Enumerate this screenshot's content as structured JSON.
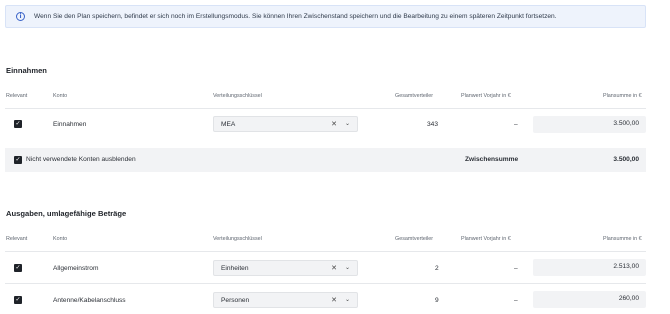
{
  "info_banner": {
    "icon": "info-icon",
    "text": "Wenn Sie den Plan speichern, befindet er sich noch im Erstellungsmodus. Sie können Ihren Zwischenstand speichern und die Bearbeitung zu einem späteren Zeitpunkt fortsetzen."
  },
  "einnahmen": {
    "title": "Einnahmen",
    "headers": {
      "relevant": "Relevant",
      "konto": "Konto",
      "verteilungsschluessel": "Verteilungsschlüssel",
      "gesamtverteiler": "Gesamtverteiler",
      "planwert": "Planwert Vorjahr in €",
      "plansumme": "Plansumme in €"
    },
    "rows": [
      {
        "konto": "Einnahmen",
        "schluessel": "MEA",
        "gesamtverteiler": "343",
        "planwert": "–",
        "plansumme": "3.500,00"
      }
    ],
    "hide_unused_label": "Nicht verwendete Konten ausblenden",
    "subtotal_label": "Zwischensumme",
    "subtotal_value": "3.500,00"
  },
  "ausgaben": {
    "title": "Ausgaben, umlagefähige Beträge",
    "headers": {
      "relevant": "Relevant",
      "konto": "Konto",
      "verteilungsschluessel": "Verteilungsschlüssel",
      "gesamtverteiler": "Gesamtverteiler",
      "planwert": "Planwert Vorjahr in €",
      "plansumme": "Plansumme in €"
    },
    "rows": [
      {
        "konto": "Allgemeinstrom",
        "schluessel": "Einheiten",
        "gesamtverteiler": "2",
        "planwert": "–",
        "plansumme": "2.513,00"
      },
      {
        "konto": "Antenne/Kabelanschluss",
        "schluessel": "Personen",
        "gesamtverteiler": "9",
        "planwert": "–",
        "plansumme": "260,00"
      }
    ]
  },
  "glyphs": {
    "check": "✓",
    "clear": "✕",
    "chevron": "⌄",
    "info": "i"
  }
}
